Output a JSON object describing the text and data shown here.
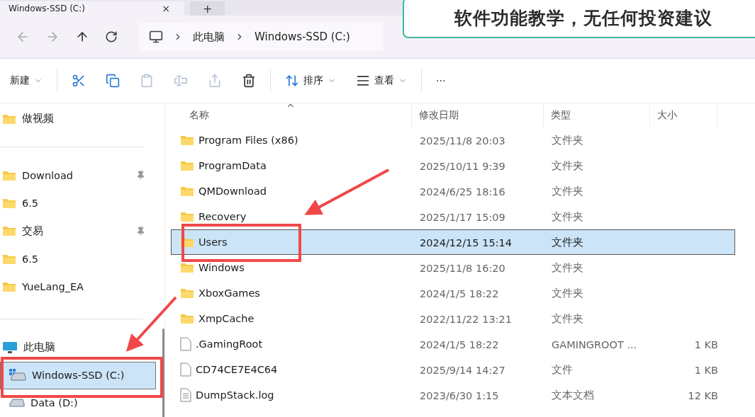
{
  "tab": {
    "title": "Windows-SSD (C:)",
    "close": "×",
    "new_tab": "+"
  },
  "breadcrumb": [
    "此电脑",
    "Windows-SSD (C:)"
  ],
  "toolbar": [
    {
      "kind": "menu",
      "label": "新建",
      "disabled": false
    },
    {
      "kind": "icon",
      "disabled": false
    },
    {
      "kind": "icon",
      "disabled": false
    },
    {
      "kind": "icon",
      "disabled": true
    },
    {
      "kind": "icon",
      "disabled": true
    },
    {
      "kind": "icon",
      "disabled": true
    },
    {
      "kind": "icon",
      "disabled": false
    },
    {
      "kind": "menu",
      "label": "排序",
      "disabled": false
    },
    {
      "kind": "menu",
      "label": "查看",
      "disabled": false
    },
    {
      "kind": "more",
      "label": "···",
      "disabled": false
    }
  ],
  "sidebar": {
    "sections": [
      [
        {
          "kind": "folder",
          "label": "做视频",
          "pinned": false,
          "selected": false
        }
      ],
      [
        {
          "kind": "folder",
          "label": "Download",
          "pinned": true,
          "selected": false
        },
        {
          "kind": "folder",
          "label": "6.5",
          "pinned": false,
          "selected": false
        },
        {
          "kind": "folder",
          "label": "交易",
          "pinned": true,
          "selected": false
        },
        {
          "kind": "folder",
          "label": "6.5",
          "pinned": false,
          "selected": false
        },
        {
          "kind": "folder",
          "label": "YueLang_EA",
          "pinned": false,
          "selected": false
        }
      ],
      [
        {
          "kind": "computer",
          "label": "此电脑",
          "pinned": false,
          "selected": false
        },
        {
          "kind": "system_drive",
          "label": "Windows-SSD (C:)",
          "pinned": false,
          "selected": true
        },
        {
          "kind": "drive",
          "label": "Data (D:)",
          "pinned": false,
          "selected": false
        }
      ]
    ]
  },
  "table": {
    "columns": [
      "名称",
      "修改日期",
      "类型",
      "大小"
    ],
    "rows": [
      {
        "kind": "folder",
        "name": "Program Files (x86)",
        "date": "2025/11/8 20:03",
        "type": "文件夹",
        "selected": false
      },
      {
        "kind": "folder",
        "name": "ProgramData",
        "date": "2025/10/11 9:39",
        "type": "文件夹",
        "selected": false
      },
      {
        "kind": "folder",
        "name": "QMDownload",
        "date": "2024/6/25 18:16",
        "type": "文件夹",
        "selected": false
      },
      {
        "kind": "folder",
        "name": "Recovery",
        "date": "2025/1/17 15:09",
        "type": "文件夹",
        "selected": false
      },
      {
        "kind": "folder",
        "name": "Users",
        "date": "2024/12/15 15:14",
        "type": "文件夹",
        "selected": true
      },
      {
        "kind": "folder",
        "name": "Windows",
        "date": "2025/11/8 16:20",
        "type": "文件夹",
        "selected": false
      },
      {
        "kind": "folder",
        "name": "XboxGames",
        "date": "2024/1/5 18:22",
        "type": "文件夹",
        "selected": false
      },
      {
        "kind": "folder",
        "name": "XmpCache",
        "date": "2022/11/22 13:21",
        "type": "文件夹",
        "selected": false
      },
      {
        "kind": "file",
        "name": ".GamingRoot",
        "date": "2024/1/5 18:22",
        "type": "GAMINGROOT ...",
        "size": "1 KB",
        "selected": false
      },
      {
        "kind": "file",
        "name": "CD74CE7E4C64",
        "date": "2025/9/14 14:27",
        "type": "文件",
        "size": "1 KB",
        "selected": false
      },
      {
        "kind": "textfile",
        "name": "DumpStack.log",
        "date": "2023/6/30 1:15",
        "type": "文本文档",
        "size": "12 KB",
        "selected": false
      }
    ]
  },
  "caption": "软件功能教学，无任何投资建议"
}
